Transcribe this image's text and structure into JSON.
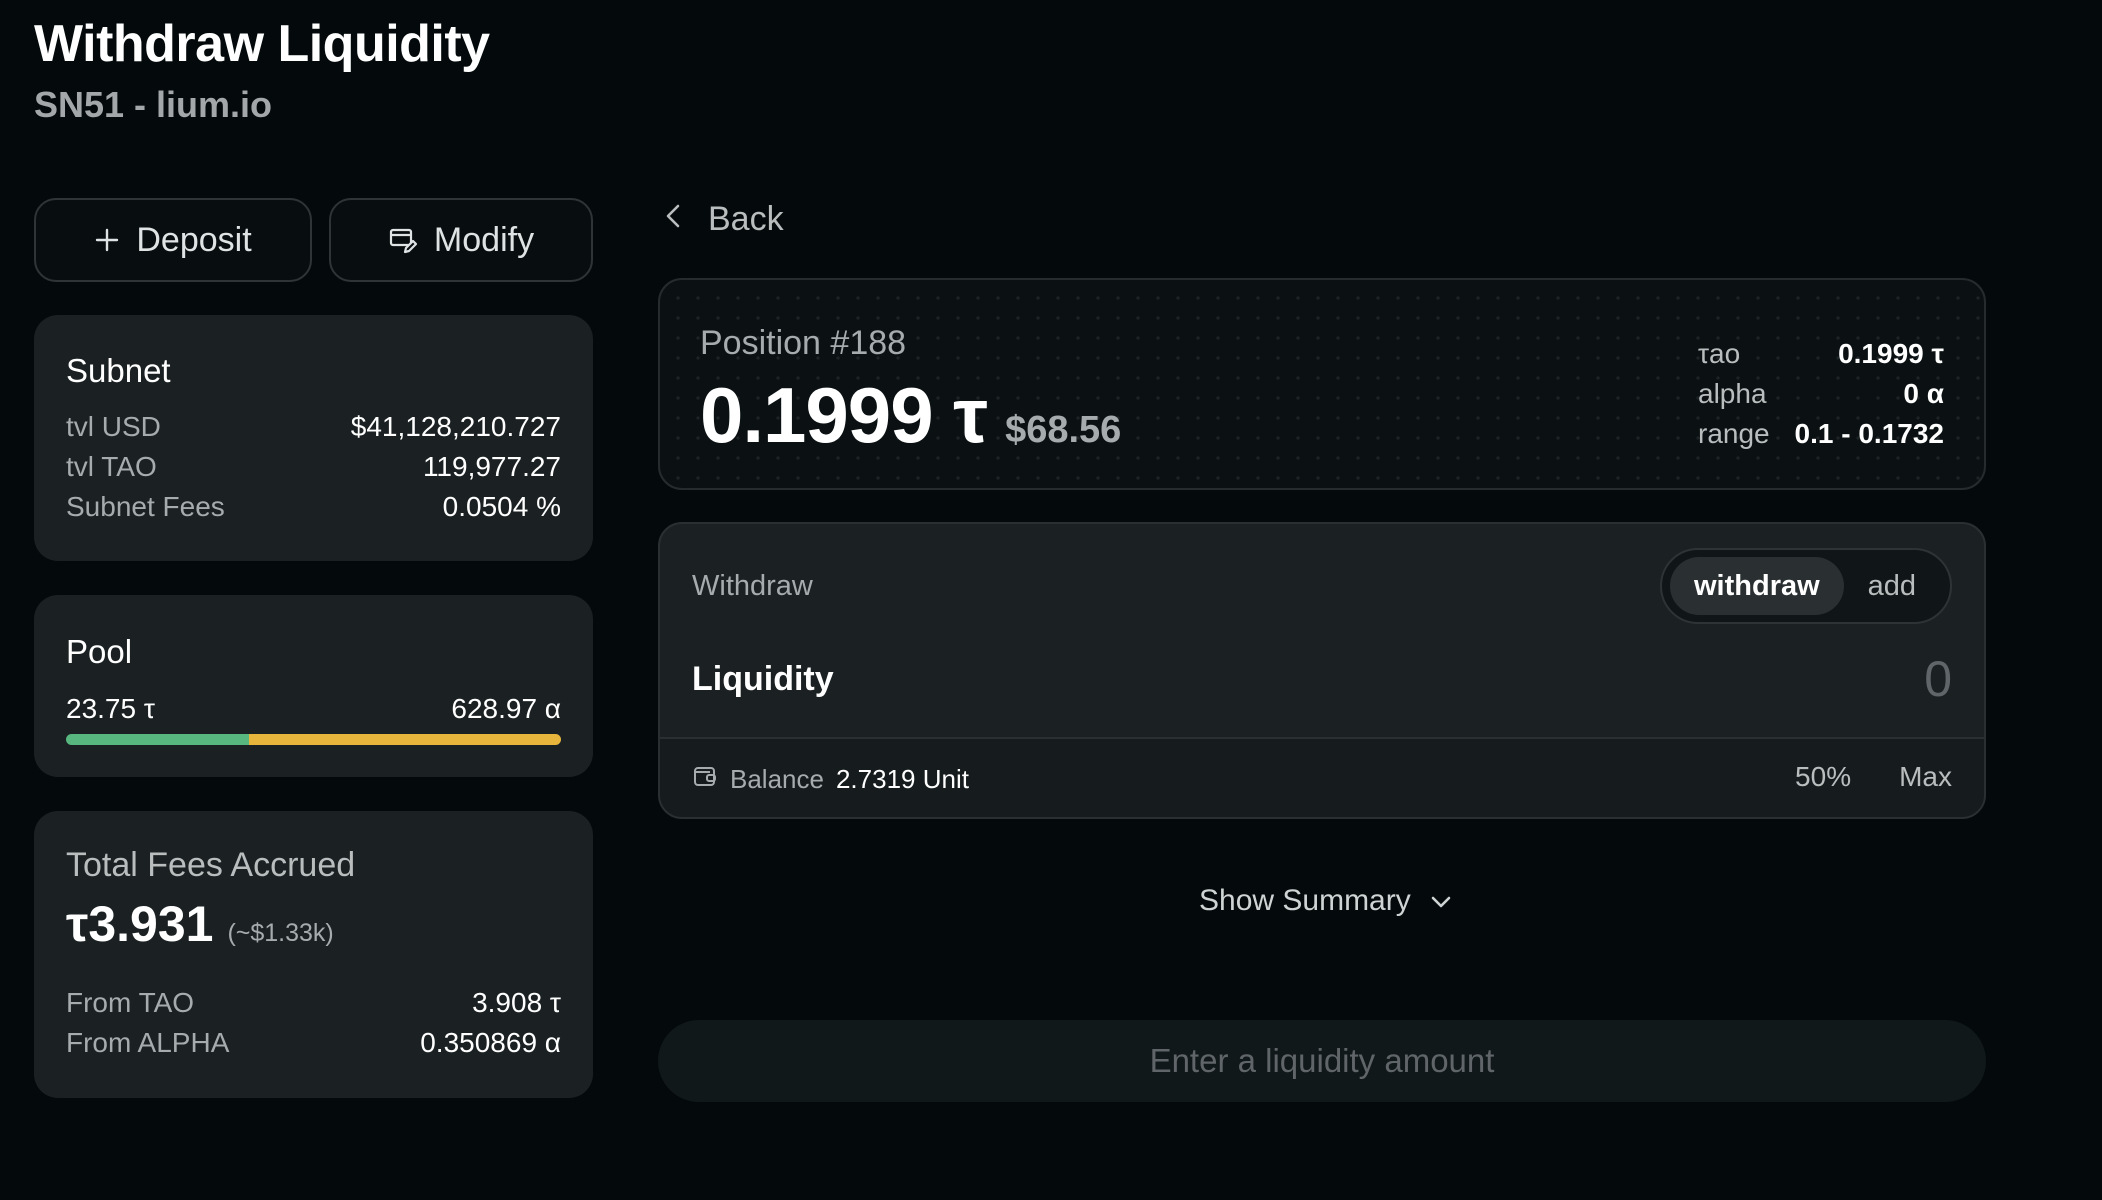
{
  "header": {
    "title": "Withdraw Liquidity",
    "subtitle": "SN51 - lium.io"
  },
  "actions": {
    "deposit_label": "Deposit",
    "modify_label": "Modify"
  },
  "subnet": {
    "title": "Subnet",
    "rows": [
      {
        "label": "tvl USD",
        "value": "$41,128,210.727"
      },
      {
        "label": "tvl TAO",
        "value": "119,977.27"
      },
      {
        "label": "Subnet Fees",
        "value": "0.0504 %"
      }
    ]
  },
  "pool": {
    "title": "Pool",
    "tao_amount": "23.75 τ",
    "alpha_amount": "628.97 α",
    "tao_share": 0.37,
    "colors": {
      "tao": "#57b77e",
      "alpha": "#e7b53c"
    }
  },
  "fees": {
    "title": "Total Fees Accrued",
    "total": "τ3.931",
    "total_usd": "(~$1.33k)",
    "rows": [
      {
        "label": "From TAO",
        "value": "3.908 τ"
      },
      {
        "label": "From ALPHA",
        "value": "0.350869 α"
      }
    ]
  },
  "nav": {
    "back_label": "Back"
  },
  "position": {
    "label": "Position #188",
    "amount": "0.1999 τ",
    "amount_usd": "$68.56",
    "stats": [
      {
        "label": "τao",
        "value": "0.1999 τ"
      },
      {
        "label": "alpha",
        "value": "0 α"
      },
      {
        "label": "range",
        "value": "0.1 - 0.1732"
      }
    ]
  },
  "withdraw": {
    "label": "Withdraw",
    "toggle": {
      "withdraw": "withdraw",
      "add": "add",
      "selected": "withdraw"
    },
    "liquidity_label": "Liquidity",
    "liquidity_value": "0",
    "balance_label": "Balance",
    "balance_value": "2.7319 Unit",
    "pct_label": "50%",
    "max_label": "Max"
  },
  "summary": {
    "label": "Show Summary"
  },
  "submit": {
    "label": "Enter a liquidity amount"
  }
}
